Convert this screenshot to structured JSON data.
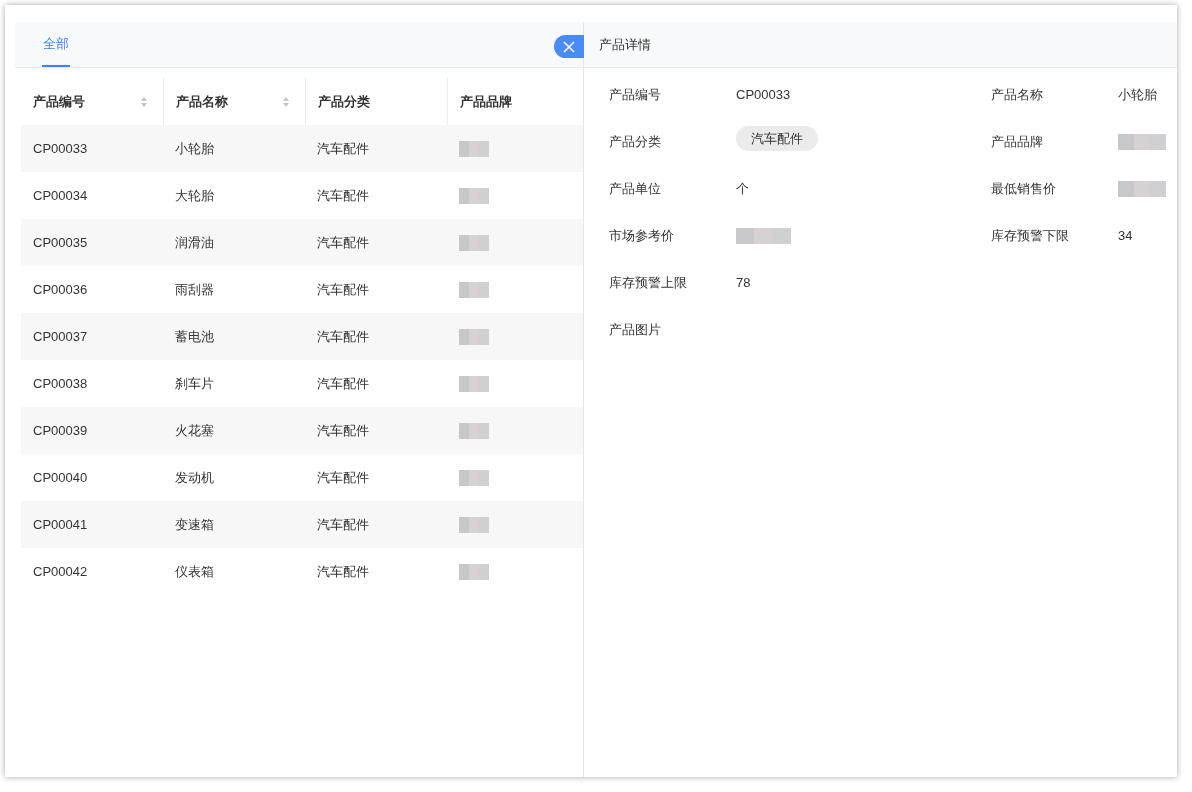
{
  "tabs": [
    {
      "label": "全部",
      "selected": true
    }
  ],
  "table": {
    "columns": [
      {
        "label": "产品编号",
        "sortable": true
      },
      {
        "label": "产品名称",
        "sortable": true
      },
      {
        "label": "产品分类",
        "sortable": false
      },
      {
        "label": "产品品牌",
        "sortable": false
      }
    ],
    "rows": [
      {
        "code": "CP00033",
        "name": "小轮胎",
        "category": "汽车配件"
      },
      {
        "code": "CP00034",
        "name": "大轮胎",
        "category": "汽车配件"
      },
      {
        "code": "CP00035",
        "name": "润滑油",
        "category": "汽车配件"
      },
      {
        "code": "CP00036",
        "name": "雨刮器",
        "category": "汽车配件"
      },
      {
        "code": "CP00037",
        "name": "蓄电池",
        "category": "汽车配件"
      },
      {
        "code": "CP00038",
        "name": "刹车片",
        "category": "汽车配件"
      },
      {
        "code": "CP00039",
        "name": "火花塞",
        "category": "汽车配件"
      },
      {
        "code": "CP00040",
        "name": "发动机",
        "category": "汽车配件"
      },
      {
        "code": "CP00041",
        "name": "变速箱",
        "category": "汽车配件"
      },
      {
        "code": "CP00042",
        "name": "仪表箱",
        "category": "汽车配件"
      }
    ]
  },
  "drawer": {
    "title": "产品详情",
    "fields": [
      {
        "label": "产品编号",
        "kind": "text",
        "value": "CP00033"
      },
      {
        "label": "产品名称",
        "kind": "text",
        "value": "小轮胎"
      },
      {
        "label": "产品分类",
        "kind": "tag",
        "value": "汽车配件"
      },
      {
        "label": "产品品牌",
        "kind": "redacted"
      },
      {
        "label": "产品单位",
        "kind": "text",
        "value": "个"
      },
      {
        "label": "最低销售价",
        "kind": "redacted"
      },
      {
        "label": "市场参考价",
        "kind": "redacted"
      },
      {
        "label": "库存预警下限",
        "kind": "text",
        "value": "34"
      },
      {
        "label": "库存预警上限",
        "kind": "text",
        "value": "78"
      },
      {
        "label": "产品图片",
        "kind": "image"
      }
    ]
  }
}
